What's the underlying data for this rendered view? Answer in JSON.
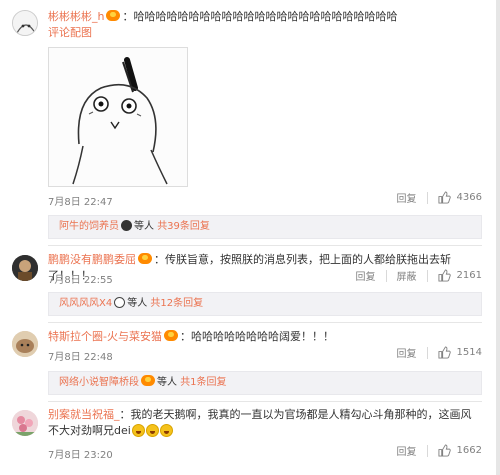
{
  "colors": {
    "accent": "#eb7350",
    "muted": "#808080",
    "subbox_bg": "#f2f2f5"
  },
  "comments": [
    {
      "user": "彬彬彬彬_h",
      "text": "：哈哈哈哈哈哈哈哈哈哈哈哈哈哈哈哈哈哈哈哈哈哈哈哈",
      "attachment_label": "评论配图",
      "date": "7月8日 22:47",
      "reply_label": "回复",
      "likes": "4366",
      "sub_user": "阿牛的饲养员",
      "sub_suffix_pre": "等人",
      "sub_count_text": "共39条回复"
    },
    {
      "user": "鹏鹏没有鹏鹏委屈",
      "text": "：传朕旨意，按照朕的消息列表，把上面的人都给朕拖出去斩了！！！",
      "date": "7月8日 22:55",
      "reply_label": "回复",
      "block_label": "屏蔽",
      "likes": "2161",
      "sub_user": "风风风风X4",
      "sub_suffix_pre": "等人",
      "sub_count_text": "共12条回复"
    },
    {
      "user": "特斯拉个圈-火与菜安猫",
      "text": "：哈哈哈哈哈哈哈哈阔爱！！！",
      "date": "7月8日 22:48",
      "reply_label": "回复",
      "likes": "1514",
      "sub_user": "网络小说智障桥段",
      "sub_suffix_pre": "等人",
      "sub_count_text": "共1条回复"
    },
    {
      "user": "别案就当祝福_",
      "text": "：我的老天鹅啊，我真的一直以为官场都是人精勾心斗角那种的，这画风不大对劲啊兄dei",
      "date": "7月8日 23:20",
      "reply_label": "回复",
      "likes": "1662"
    }
  ]
}
